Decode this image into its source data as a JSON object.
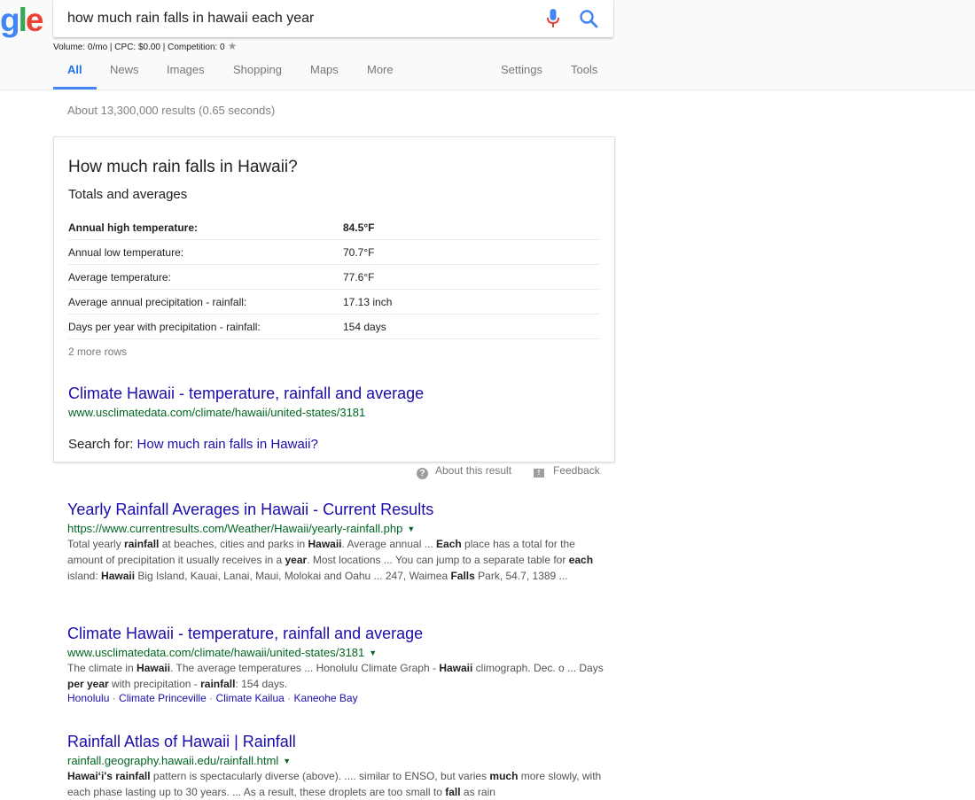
{
  "logo": {
    "text": "gle"
  },
  "search": {
    "query": "how much rain falls in hawaii each year"
  },
  "seo_bar": {
    "text": "Volume: 0/mo | CPC: $0.00 | Competition: 0"
  },
  "tabs": [
    {
      "label": "All"
    },
    {
      "label": "News"
    },
    {
      "label": "Images"
    },
    {
      "label": "Shopping"
    },
    {
      "label": "Maps"
    },
    {
      "label": "More"
    },
    {
      "label": "Settings"
    },
    {
      "label": "Tools"
    }
  ],
  "stats": "About 13,300,000 results (0.65 seconds)",
  "featured": {
    "question": "How much rain falls in Hawaii?",
    "subtitle": "Totals and averages",
    "rows": [
      {
        "key": "Annual high temperature:",
        "value": "84.5°F"
      },
      {
        "key": "Annual low temperature:",
        "value": "70.7°F"
      },
      {
        "key": "Average temperature:",
        "value": "77.6°F"
      },
      {
        "key": "Average annual precipitation - rainfall:",
        "value": "17.13 inch"
      },
      {
        "key": "Days per year with precipitation - rainfall:",
        "value": "154 days"
      }
    ],
    "more_rows": "2 more rows",
    "source_title": "Climate Hawaii - temperature, rainfall and average",
    "source_url": "www.usclimatedata.com/climate/hawaii/united-states/3181",
    "search_for_prefix": "Search for:",
    "search_for_link": "How much rain falls in Hawaii?",
    "about": "About this result",
    "feedback": "Feedback"
  },
  "results": [
    {
      "title": "Yearly Rainfall Averages in Hawaii - Current Results",
      "url": "https://www.currentresults.com/Weather/Hawaii/yearly-rainfall.php"
    },
    {
      "title": "Climate Hawaii - temperature, rainfall and average",
      "url": "www.usclimatedata.com/climate/hawaii/united-states/3181",
      "sitelinks": [
        "Honolulu",
        "Climate Princeville",
        "Climate Kailua",
        "Kaneohe Bay"
      ]
    },
    {
      "title": "Rainfall Atlas of Hawaii | Rainfall",
      "url": "rainfall.geography.hawaii.edu/rainfall.html"
    }
  ],
  "snippets": {
    "r1": [
      "Total yearly ",
      "rainfall",
      " at beaches, cities and parks in ",
      "Hawaii",
      ". Average annual ... ",
      "Each",
      " place has a total for the amount of precipitation it usually receives in a ",
      "year",
      ". Most locations ... You can jump to a separate table for ",
      "each",
      " island: ",
      "Hawaii",
      " Big Island, Kauai, Lanai, Maui, Molokai and Oahu ... 247, Waimea ",
      "Falls",
      " Park, 54.7, 1389 ..."
    ],
    "r2": [
      "The climate in ",
      "Hawaii",
      ". The average temperatures ... Honolulu Climate Graph - ",
      "Hawaii",
      " climograph. Dec. o ... Days ",
      "per year",
      " with precipitation - ",
      "rainfall",
      ": 154 days."
    ],
    "r3": [
      "Hawai‘i's",
      " ",
      "rainfall",
      " pattern is spectacularly diverse (above). .... similar to ENSO, but varies ",
      "much",
      " more slowly, with each phase lasting up to 30 years. ... As a result, these droplets are too small to ",
      "fall",
      " as rain"
    ]
  },
  "icons": {
    "mic": "microphone-icon",
    "search": "magnifier-icon",
    "star": "star-icon",
    "help": "question-circle-icon",
    "feedback": "feedback-flag-icon",
    "caret": "caret-down-icon"
  },
  "colors": {
    "link": "#1a0dab",
    "url": "#006621",
    "active_tab": "#4285f4"
  }
}
